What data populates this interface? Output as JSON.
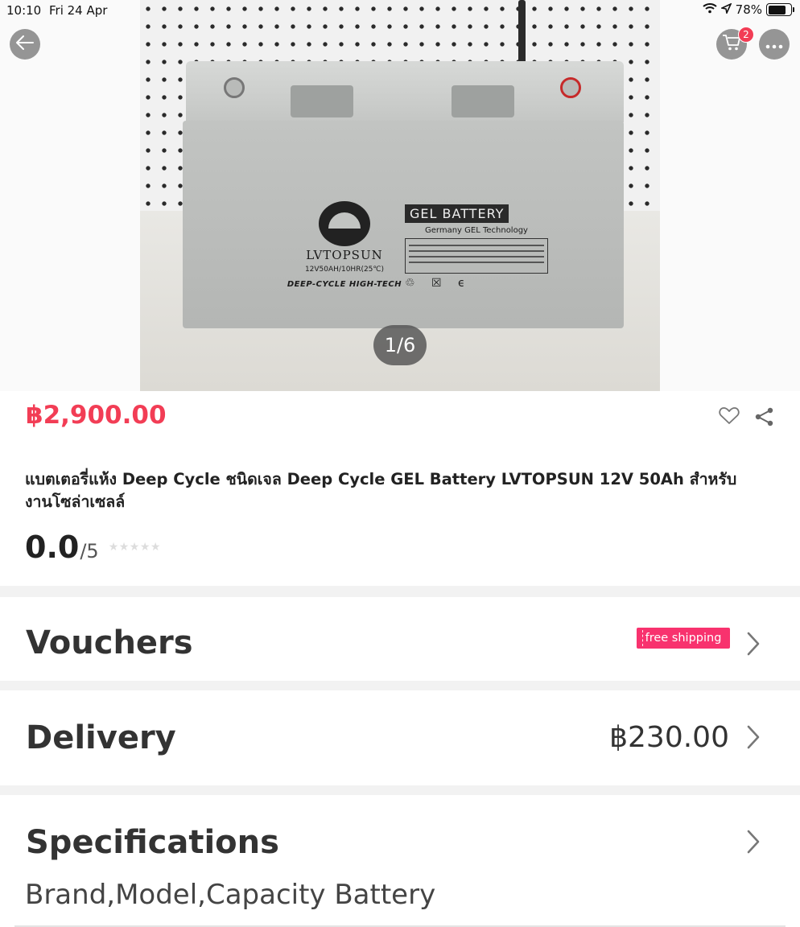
{
  "status_bar": {
    "time": "10:10",
    "date": "Fri 24 Apr",
    "battery_percent": "78%",
    "battery_level": 0.78
  },
  "gallery": {
    "counter": "1/6",
    "photo": {
      "logo_name": "LVTOPSUN",
      "logo_spec": "12V50AH/10HR(25℃)",
      "logo_tagline": "DEEP-CYCLE  HIGH-TECH",
      "label_title": "GEL BATTERY",
      "label_subtitle": "Germany GEL Technology"
    }
  },
  "header": {
    "cart_badge": "2"
  },
  "product": {
    "price": "฿2,900.00",
    "title": "แบตเตอรี่แห้ง Deep Cycle ชนิดเจล Deep Cycle GEL Battery LVTOPSUN 12V 50Ah สำหรับงานโซล่าเซลล์",
    "rating_score": "0.0",
    "rating_max": "/5",
    "stars": "★★★★★",
    "star_rating": 0
  },
  "vouchers": {
    "label": "Vouchers",
    "tag": "free shipping"
  },
  "delivery": {
    "label": "Delivery",
    "price": "฿230.00"
  },
  "specifications": {
    "label": "Specifications",
    "summary": "Brand,Model,Capacity Battery"
  },
  "colors": {
    "accent": "#f23d55",
    "voucher_tag": "#f8326e",
    "separator": "#f2f2f2"
  }
}
